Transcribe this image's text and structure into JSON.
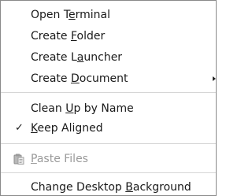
{
  "menu": {
    "items": [
      {
        "pre": "Open T",
        "mn": "e",
        "post": "rminal"
      },
      {
        "pre": "Create ",
        "mn": "F",
        "post": "older"
      },
      {
        "pre": "Create L",
        "mn": "a",
        "post": "uncher"
      },
      {
        "pre": "Create ",
        "mn": "D",
        "post": "ocument"
      },
      {
        "pre": "Clean ",
        "mn": "U",
        "post": "p by Name"
      },
      {
        "pre": "",
        "mn": "K",
        "post": "eep Aligned",
        "check": "✓"
      },
      {
        "pre": "",
        "mn": "P",
        "post": "aste Files"
      },
      {
        "pre": "Change Desktop ",
        "mn": "B",
        "post": "ackground"
      }
    ]
  }
}
